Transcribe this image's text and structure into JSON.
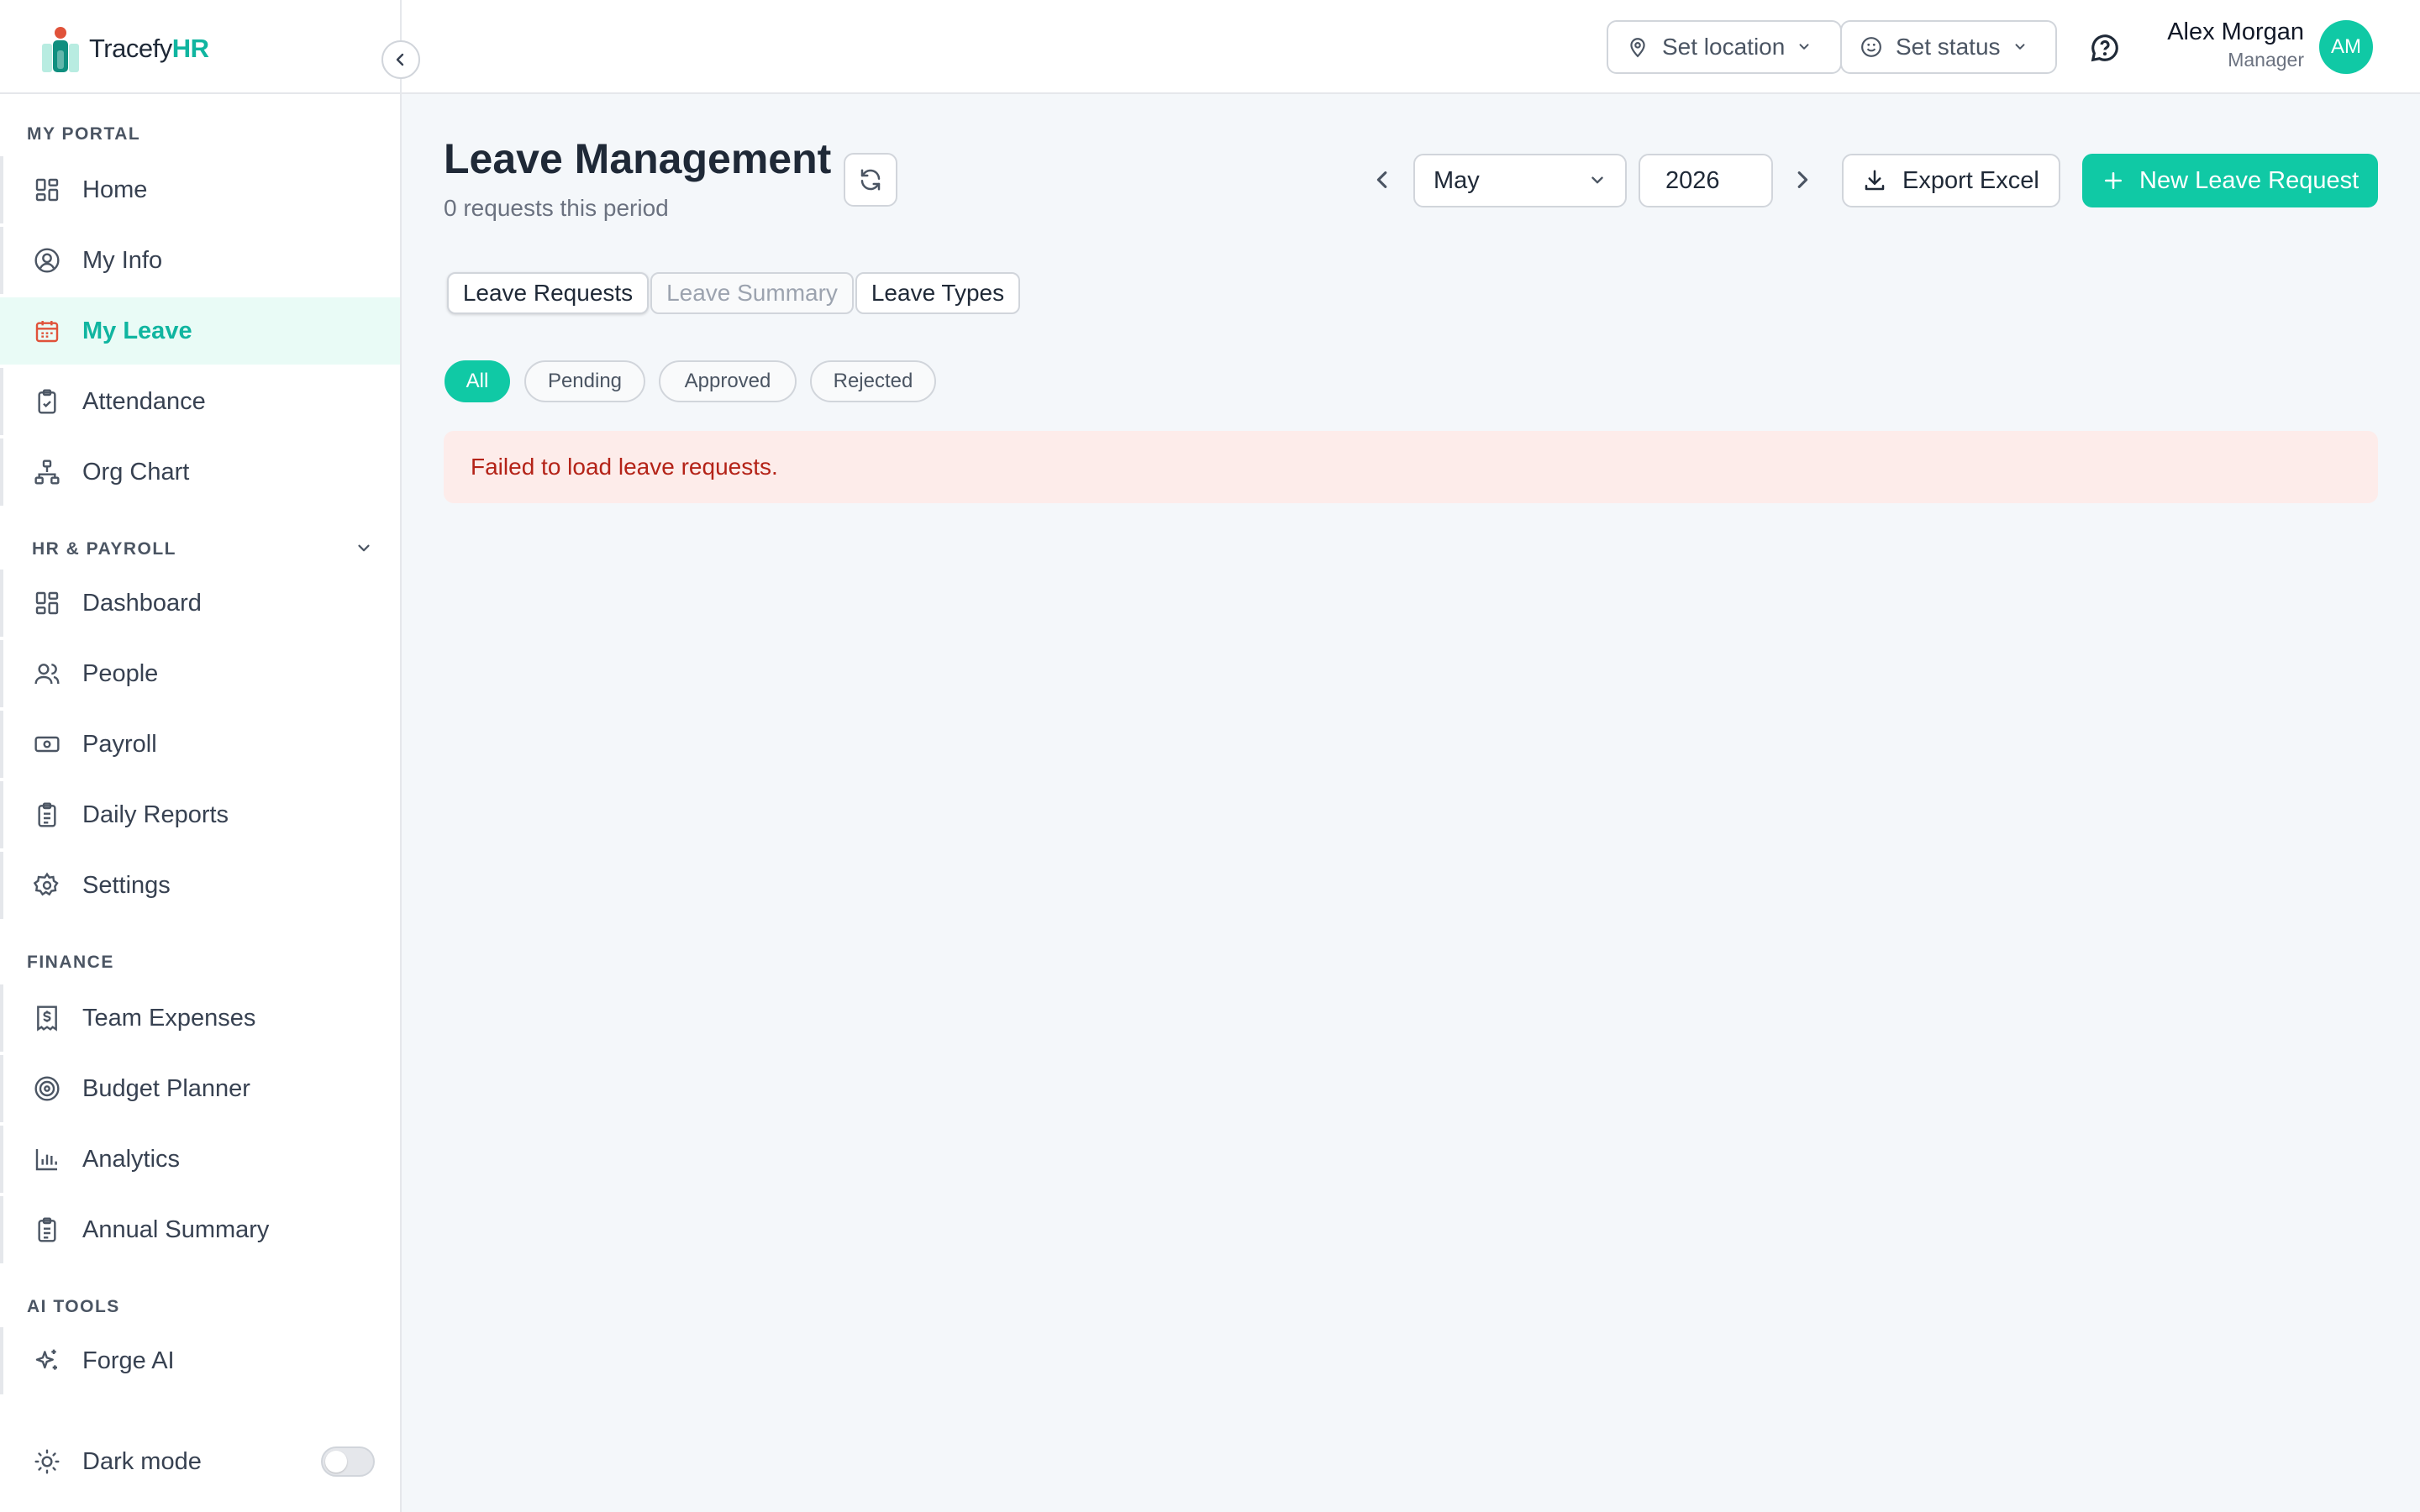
{
  "brand": {
    "name_prefix": "Tracefy",
    "name_suffix": "HR"
  },
  "sidebar": {
    "sections": [
      {
        "label": "MY PORTAL",
        "items": [
          {
            "label": "Home",
            "icon": "grid-icon"
          },
          {
            "label": "My Info",
            "icon": "user-circle-icon"
          },
          {
            "label": "My Leave",
            "icon": "calendar-icon",
            "active": true
          },
          {
            "label": "Attendance",
            "icon": "clipboard-check-icon"
          },
          {
            "label": "Org Chart",
            "icon": "org-chart-icon"
          }
        ]
      },
      {
        "label": "HR & PAYROLL",
        "items": [
          {
            "label": "Dashboard",
            "icon": "grid-icon"
          },
          {
            "label": "People",
            "icon": "users-icon"
          },
          {
            "label": "Payroll",
            "icon": "banknote-icon"
          },
          {
            "label": "Daily Reports",
            "icon": "clipboard-list-icon"
          },
          {
            "label": "Settings",
            "icon": "gear-icon"
          }
        ]
      },
      {
        "label": "FINANCE",
        "items": [
          {
            "label": "Team Expenses",
            "icon": "receipt-dollar-icon"
          },
          {
            "label": "Budget Planner",
            "icon": "target-icon"
          },
          {
            "label": "Analytics",
            "icon": "bar-chart-icon"
          },
          {
            "label": "Annual Summary",
            "icon": "clipboard-list-icon"
          }
        ]
      },
      {
        "label": "AI TOOLS",
        "items": [
          {
            "label": "Forge AI",
            "icon": "sparkles-icon"
          }
        ]
      }
    ],
    "dark_mode_label": "Dark mode"
  },
  "topbar": {
    "location_label": "Set location",
    "status_label": "Set status",
    "user": {
      "name": "Alex Morgan",
      "role": "Manager",
      "initials": "AM"
    }
  },
  "main": {
    "title": "Leave Management",
    "subtitle": "0 requests this period",
    "period": {
      "month": "May",
      "year": "2026"
    },
    "export_label": "Export Excel",
    "new_request_label": "New Leave Request",
    "tabs": [
      {
        "label": "Leave Requests",
        "state": "active"
      },
      {
        "label": "Leave Summary",
        "state": "muted"
      },
      {
        "label": "Leave Types",
        "state": "normal"
      }
    ],
    "filters": [
      {
        "label": "All",
        "active": true
      },
      {
        "label": "Pending"
      },
      {
        "label": "Approved"
      },
      {
        "label": "Rejected"
      }
    ],
    "error_message": "Failed to load leave requests."
  },
  "colors": {
    "accent": "#10c9a5",
    "accent_text": "#10b5a0",
    "error_bg": "#fdecea",
    "error_text": "#b42318",
    "active_nav_icon": "#e0523a"
  }
}
